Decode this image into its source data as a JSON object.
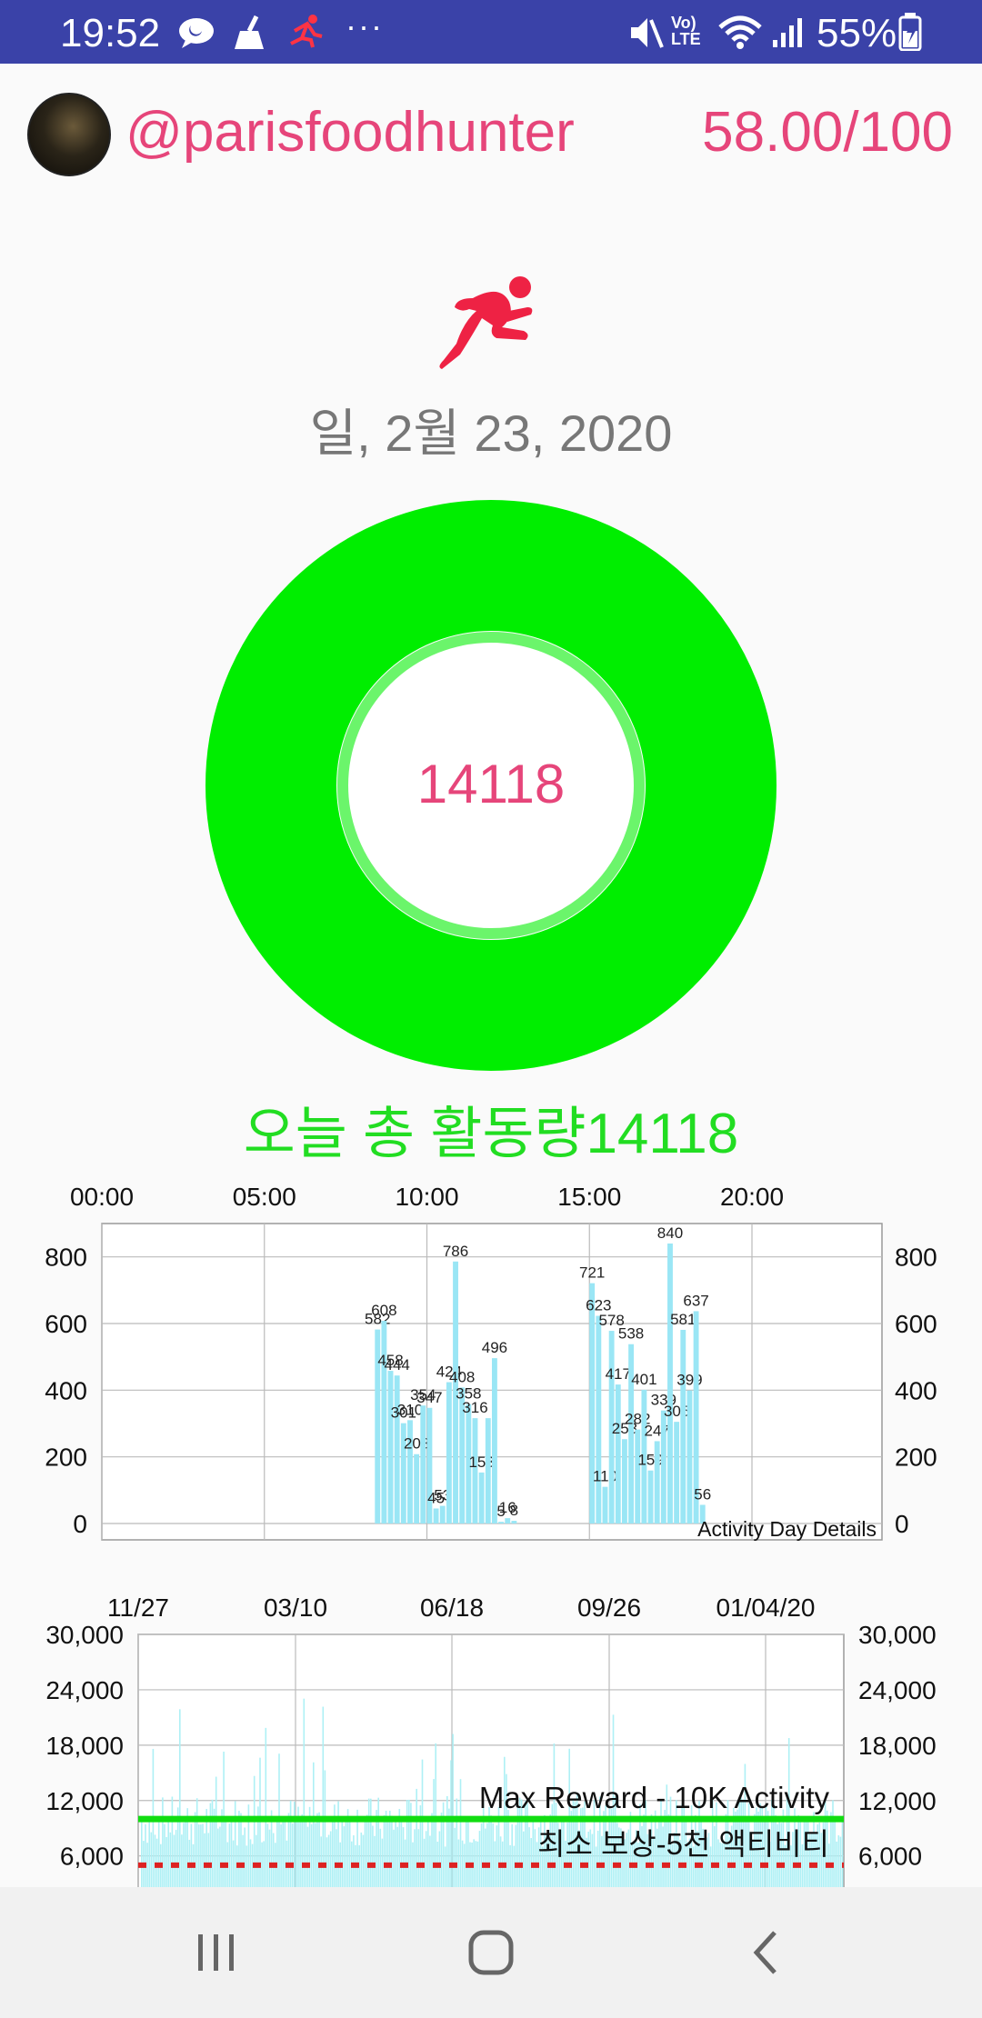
{
  "status_bar": {
    "time": "19:52",
    "battery_percent": "55%",
    "icons": [
      "chat-bubble-icon",
      "broom-icon",
      "runner-icon",
      "more-dots-icon",
      "mute-icon",
      "volte-icon",
      "wifi-icon",
      "signal-icon",
      "battery-icon"
    ],
    "dots": "···",
    "volte": "Vo)\nLTE"
  },
  "header": {
    "username": "@parisfoodhunter",
    "score": "58.00/100"
  },
  "date": "일, 2월 23, 2020",
  "ring": {
    "value": "14118",
    "color": "#00ee00",
    "inner_color": "#6bf56b"
  },
  "activity_label": "오늘 총 활동량14118",
  "day_chart": {
    "type": "bar",
    "description": "Activity Day Details",
    "x_tick_labels": [
      "00:00",
      "05:00",
      "10:00",
      "15:00",
      "20:00"
    ],
    "y_tick_labels": [
      "0",
      "200",
      "400",
      "600",
      "800"
    ],
    "ylim": [
      0,
      900
    ],
    "bar_color": "#9ae6f5",
    "grid": true,
    "x_hours": [
      8.4,
      8.6,
      8.8,
      9.0,
      9.2,
      9.4,
      9.6,
      9.8,
      10.0,
      10.2,
      10.4,
      10.6,
      10.8,
      11.0,
      11.2,
      11.4,
      11.6,
      11.8,
      12.0,
      12.2,
      12.4,
      12.6,
      12.8,
      13.0,
      13.2,
      15.0,
      15.2,
      15.4,
      15.6,
      15.8,
      16.0,
      16.2,
      16.4,
      16.6,
      16.8,
      17.0,
      17.2,
      17.4,
      17.6,
      17.8,
      18.0,
      18.2,
      18.4,
      18.6,
      18.8,
      19.0,
      19.2
    ],
    "values": [
      582,
      608,
      458,
      444,
      301,
      310,
      208,
      354,
      347,
      45,
      53,
      424,
      786,
      408,
      358,
      316,
      153,
      316,
      496,
      5,
      16,
      8,
      0,
      0,
      0,
      721,
      623,
      110,
      578,
      417,
      253,
      538,
      282,
      401,
      159,
      247,
      339,
      840,
      305,
      581,
      399,
      637,
      56,
      0,
      0,
      0,
      0
    ],
    "labels": [
      "582",
      "608",
      "458",
      "444",
      "301",
      "310",
      "208",
      "354",
      "347",
      "45",
      "53",
      "424",
      "786",
      "408",
      "358",
      "316",
      "153",
      "",
      "496",
      "5",
      "16",
      "8",
      "",
      "",
      "",
      "721",
      "623",
      "110",
      "578",
      "417",
      "253",
      "538",
      "282",
      "401",
      "159",
      "247",
      "339",
      "840",
      "305",
      "581",
      "399",
      "637",
      "56",
      "",
      "",
      "",
      ""
    ]
  },
  "history_chart": {
    "type": "bar",
    "x_tick_labels": [
      "11/27",
      "03/10",
      "06/18",
      "09/26",
      "01/04/20"
    ],
    "y_tick_labels": [
      "6,000",
      "12,000",
      "18,000",
      "24,000",
      "30,000"
    ],
    "ylim": [
      4000,
      30000
    ],
    "bar_color": "#aef0f5",
    "max_reward_label": "Max Reward - 10K Activity",
    "max_reward_value": 10000,
    "max_reward_color": "#11dd11",
    "min_reward_label": "최소 보상-5천 액티비티",
    "min_reward_value": 5000,
    "min_reward_color": "#dd2222"
  },
  "nav": {
    "recents": "recents-icon",
    "home": "home-icon",
    "back": "back-icon"
  }
}
